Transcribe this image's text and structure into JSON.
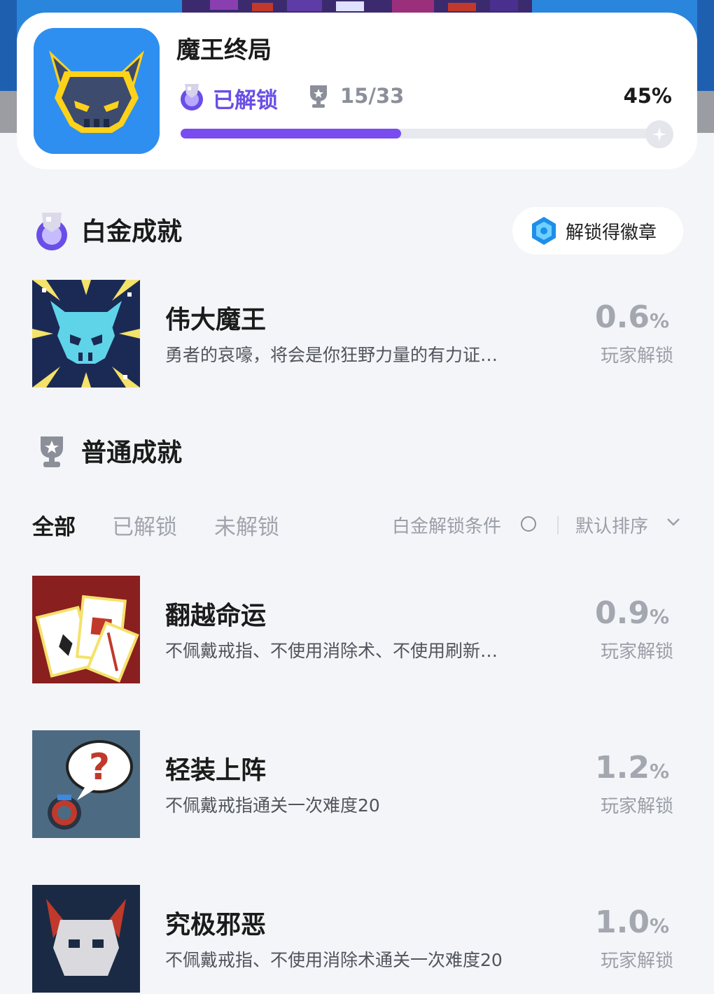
{
  "game": {
    "title": "魔王终局",
    "status_label": "已解锁",
    "progress_count": "15/33",
    "progress_percent_label": "45%",
    "progress_fraction": 0.45
  },
  "platinum_section": {
    "title": "白金成就",
    "badge_button_label": "解锁得徽章"
  },
  "platinum_achievement": {
    "name": "伟大魔王",
    "description": "勇者的哀嚎，将会是你狂野力量的有力证…",
    "rate_value": "0.6",
    "rate_unit": "%",
    "rate_label": "玩家解锁"
  },
  "normal_section": {
    "title": "普通成就"
  },
  "filters": {
    "tabs": [
      "全部",
      "已解锁",
      "未解锁"
    ],
    "platinum_condition_label": "白金解锁条件",
    "sort_label": "默认排序"
  },
  "achievements": [
    {
      "name": "翻越命运",
      "description": "不佩戴戒指、不使用消除术、不使用刷新…",
      "rate_value": "0.9",
      "rate_unit": "%",
      "rate_label": "玩家解锁"
    },
    {
      "name": "轻装上阵",
      "description": "不佩戴戒指通关一次难度20",
      "rate_value": "1.2",
      "rate_unit": "%",
      "rate_label": "玩家解锁"
    },
    {
      "name": "究极邪恶",
      "description": "不佩戴戒指、不使用消除术通关一次难度20",
      "rate_value": "1.0",
      "rate_unit": "%",
      "rate_label": "玩家解锁"
    }
  ],
  "colors": {
    "accent": "#7a4cf0",
    "page_bg": "#f4f5f8"
  }
}
